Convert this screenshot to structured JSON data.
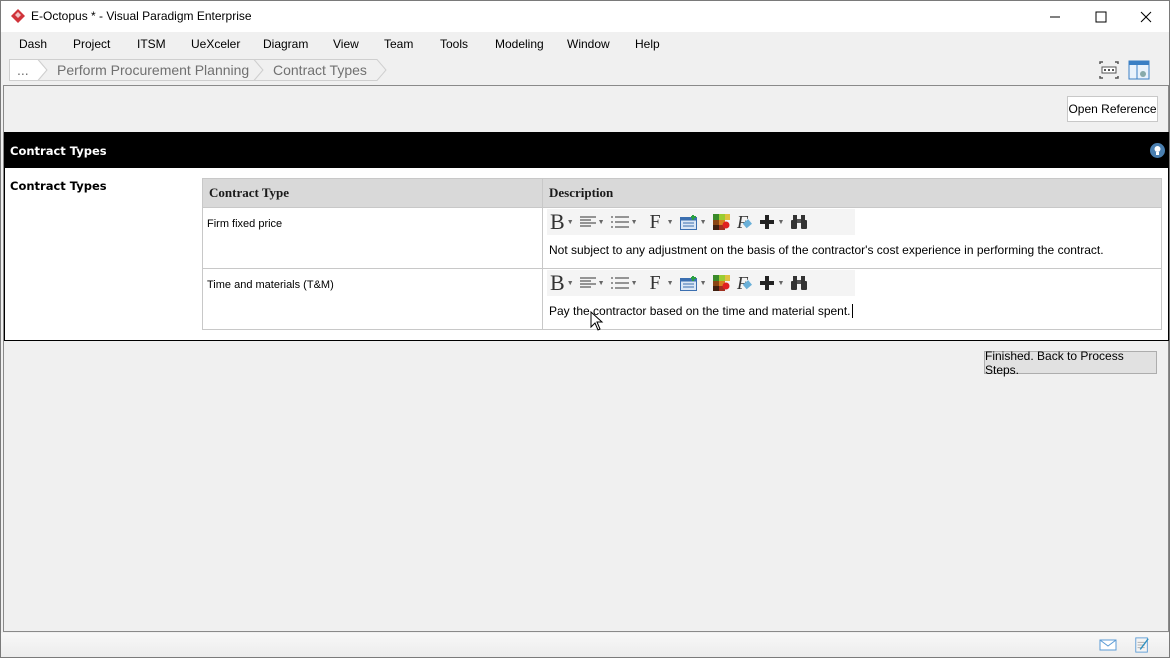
{
  "window": {
    "title": "E-Octopus * - Visual Paradigm Enterprise",
    "controls": {
      "minimize": "minimize",
      "maximize": "maximize",
      "close": "close"
    }
  },
  "menu": [
    "Dash",
    "Project",
    "ITSM",
    "UeXceler",
    "Diagram",
    "View",
    "Team",
    "Tools",
    "Modeling",
    "Window",
    "Help"
  ],
  "breadcrumb": [
    "...",
    "Perform Procurement Planning",
    "Contract Types"
  ],
  "toolbar": {
    "open_reference": "Open Reference"
  },
  "section": {
    "title": "Contract Types",
    "field_label": "Contract Types",
    "table": {
      "columns": [
        "Contract Type",
        "Description"
      ],
      "rows": [
        {
          "type": "Firm fixed price",
          "description": "Not subject to any adjustment on the basis of the contractor's cost experience in performing the contract."
        },
        {
          "type": "Time and materials (T&M)",
          "description": "Pay the contractor based on the time and material spent."
        }
      ]
    },
    "editor_toolbar": [
      "bold-icon",
      "align-icon",
      "list-icon",
      "font-icon",
      "table-icon",
      "color-icon",
      "format-icon",
      "insert-icon",
      "find-icon"
    ]
  },
  "actions": {
    "finished": "Finished. Back to Process Steps."
  },
  "colors": {
    "header_bg": "#000000",
    "table_header_bg": "#d9d9d9",
    "app_logo": "#d0333a",
    "hint": "#4a7fb0"
  }
}
